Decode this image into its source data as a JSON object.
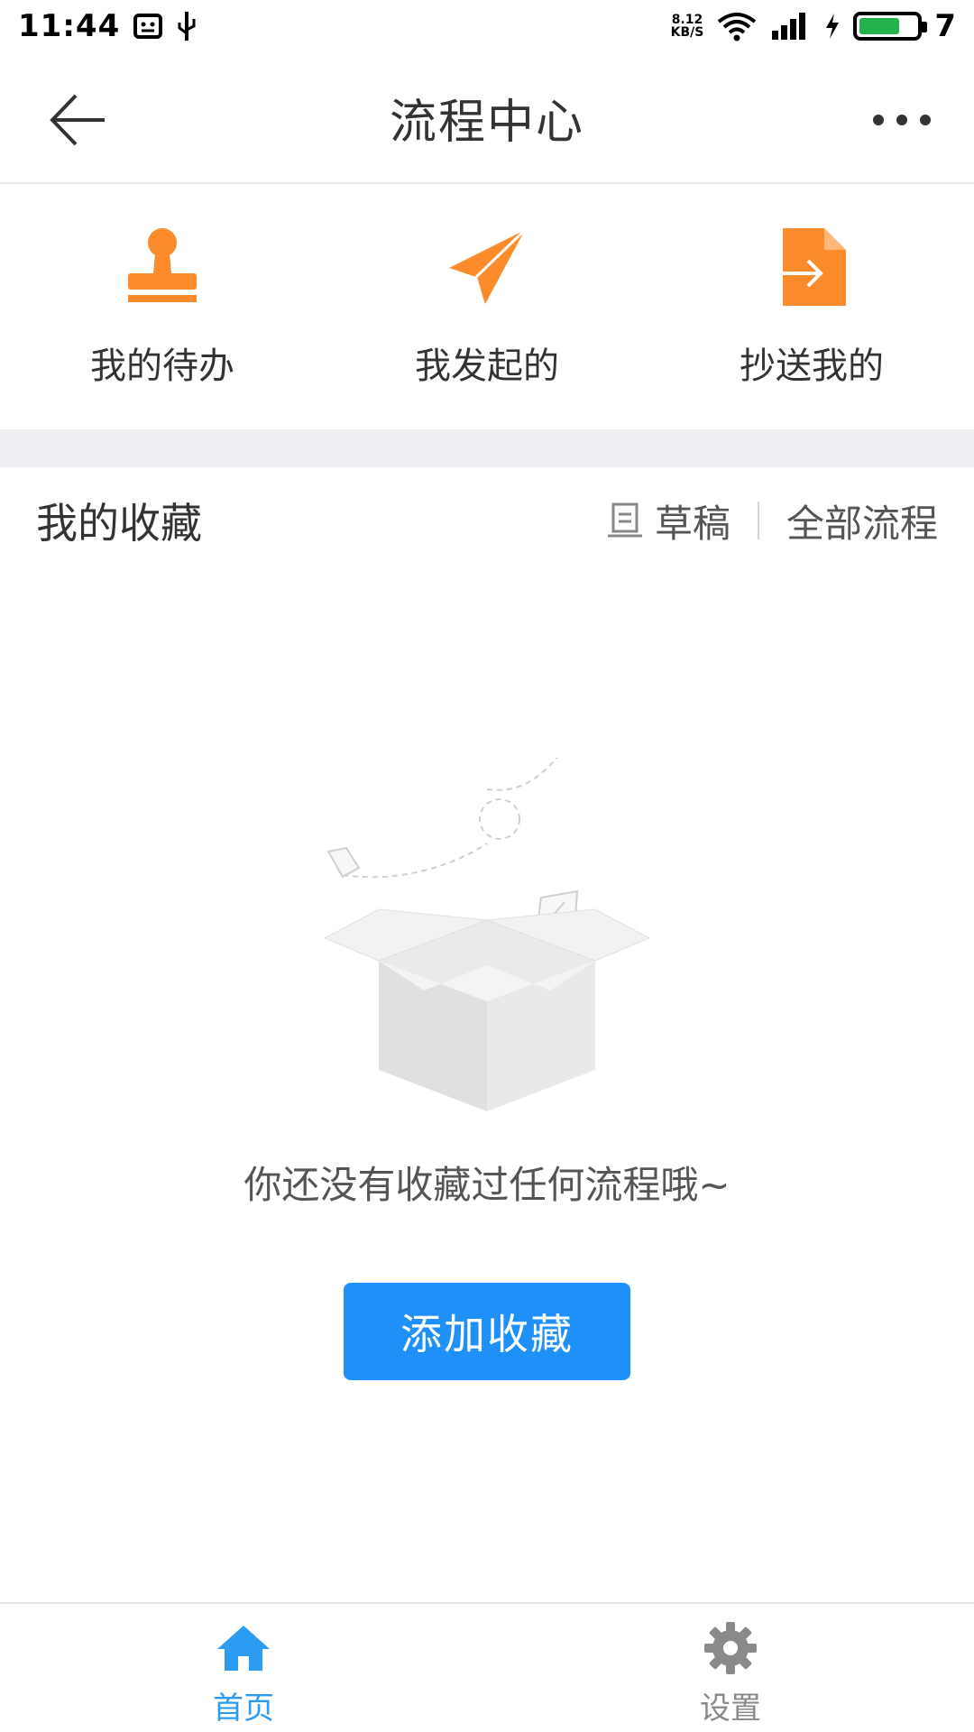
{
  "status_bar": {
    "time": "11:44",
    "net_speed_value": "8.12",
    "net_speed_unit": "KB/S",
    "battery_level": "7",
    "icons": [
      "notification-icon",
      "usb-icon",
      "wifi-icon",
      "signal-icon",
      "charging-icon",
      "battery-icon"
    ]
  },
  "header": {
    "title": "流程中心",
    "back_icon": "back-arrow-icon",
    "more_icon": "more-dots-icon"
  },
  "quick_entries": [
    {
      "label": "我的待办",
      "icon": "stamp-icon"
    },
    {
      "label": "我发起的",
      "icon": "paper-plane-icon"
    },
    {
      "label": "抄送我的",
      "icon": "document-forward-icon"
    }
  ],
  "favorites": {
    "title": "我的收藏",
    "draft_label": "草稿",
    "all_label": "全部流程",
    "empty_text": "你还没有收藏过任何流程哦~",
    "add_button": "添加收藏"
  },
  "bottom_nav": [
    {
      "label": "首页",
      "icon": "home-icon",
      "active": true
    },
    {
      "label": "设置",
      "icon": "settings-icon",
      "active": false
    }
  ],
  "colors": {
    "accent_orange": "#fb8b2b",
    "primary_blue": "#1e90f8",
    "nav_active": "#2b9cf2",
    "nav_inactive": "#8a8a8a"
  }
}
